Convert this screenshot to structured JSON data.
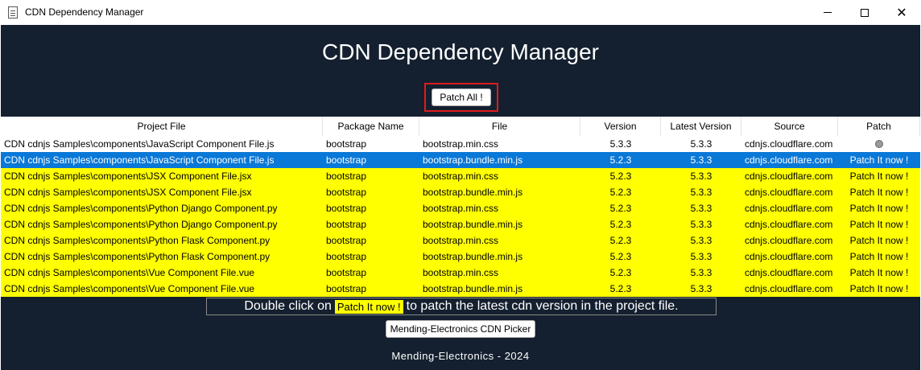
{
  "window": {
    "title": "CDN Dependency Manager",
    "minimize_icon": "minimize-icon",
    "maximize_icon": "maximize-icon",
    "close_icon": "close-icon"
  },
  "heading": "CDN Dependency Manager",
  "patch_all_label": "Patch All !",
  "table": {
    "columns": [
      "Project File",
      "Package Name",
      "File",
      "Version",
      "Latest Version",
      "Source",
      "Patch"
    ],
    "rows": [
      {
        "project_file": "CDN cdnjs Samples\\components\\JavaScript Component File.js",
        "package": "bootstrap",
        "file": "bootstrap.min.css",
        "version": "5.3.3",
        "latest": "5.3.3",
        "source": "cdnjs.cloudflare.com",
        "patch": "",
        "state": "normal"
      },
      {
        "project_file": "CDN cdnjs Samples\\components\\JavaScript Component File.js",
        "package": "bootstrap",
        "file": "bootstrap.bundle.min.js",
        "version": "5.2.3",
        "latest": "5.3.3",
        "source": "cdnjs.cloudflare.com",
        "patch": "Patch It now !",
        "state": "selected"
      },
      {
        "project_file": "CDN cdnjs Samples\\components\\JSX Component File.jsx",
        "package": "bootstrap",
        "file": "bootstrap.min.css",
        "version": "5.2.3",
        "latest": "5.3.3",
        "source": "cdnjs.cloudflare.com",
        "patch": "Patch It now !",
        "state": "outdated"
      },
      {
        "project_file": "CDN cdnjs Samples\\components\\JSX Component File.jsx",
        "package": "bootstrap",
        "file": "bootstrap.bundle.min.js",
        "version": "5.2.3",
        "latest": "5.3.3",
        "source": "cdnjs.cloudflare.com",
        "patch": "Patch It now !",
        "state": "outdated"
      },
      {
        "project_file": "CDN cdnjs Samples\\components\\Python Django Component.py",
        "package": "bootstrap",
        "file": "bootstrap.min.css",
        "version": "5.2.3",
        "latest": "5.3.3",
        "source": "cdnjs.cloudflare.com",
        "patch": "Patch It now !",
        "state": "outdated"
      },
      {
        "project_file": "CDN cdnjs Samples\\components\\Python Django Component.py",
        "package": "bootstrap",
        "file": "bootstrap.bundle.min.js",
        "version": "5.2.3",
        "latest": "5.3.3",
        "source": "cdnjs.cloudflare.com",
        "patch": "Patch It now !",
        "state": "outdated"
      },
      {
        "project_file": "CDN cdnjs Samples\\components\\Python Flask Component.py",
        "package": "bootstrap",
        "file": "bootstrap.min.css",
        "version": "5.2.3",
        "latest": "5.3.3",
        "source": "cdnjs.cloudflare.com",
        "patch": "Patch It now !",
        "state": "outdated"
      },
      {
        "project_file": "CDN cdnjs Samples\\components\\Python Flask Component.py",
        "package": "bootstrap",
        "file": "bootstrap.bundle.min.js",
        "version": "5.2.3",
        "latest": "5.3.3",
        "source": "cdnjs.cloudflare.com",
        "patch": "Patch It now !",
        "state": "outdated"
      },
      {
        "project_file": "CDN cdnjs Samples\\components\\Vue Component File.vue",
        "package": "bootstrap",
        "file": "bootstrap.min.css",
        "version": "5.2.3",
        "latest": "5.3.3",
        "source": "cdnjs.cloudflare.com",
        "patch": "Patch It now !",
        "state": "outdated"
      },
      {
        "project_file": "CDN cdnjs Samples\\components\\Vue Component File.vue",
        "package": "bootstrap",
        "file": "bootstrap.bundle.min.js",
        "version": "5.2.3",
        "latest": "5.3.3",
        "source": "cdnjs.cloudflare.com",
        "patch": "Patch It now !",
        "state": "outdated"
      }
    ]
  },
  "hint": {
    "before": "Double click on",
    "chip": "Patch It now !",
    "after": "to patch the latest cdn version in the project file."
  },
  "picker_label": "Mending-Electronics CDN Picker",
  "footer": "Mending-Electronics - 2024",
  "colors": {
    "background": "#14202f",
    "selected_row": "#0a78d7",
    "outdated_row": "#ffff00",
    "patch_all_border": "#e01b1b"
  }
}
